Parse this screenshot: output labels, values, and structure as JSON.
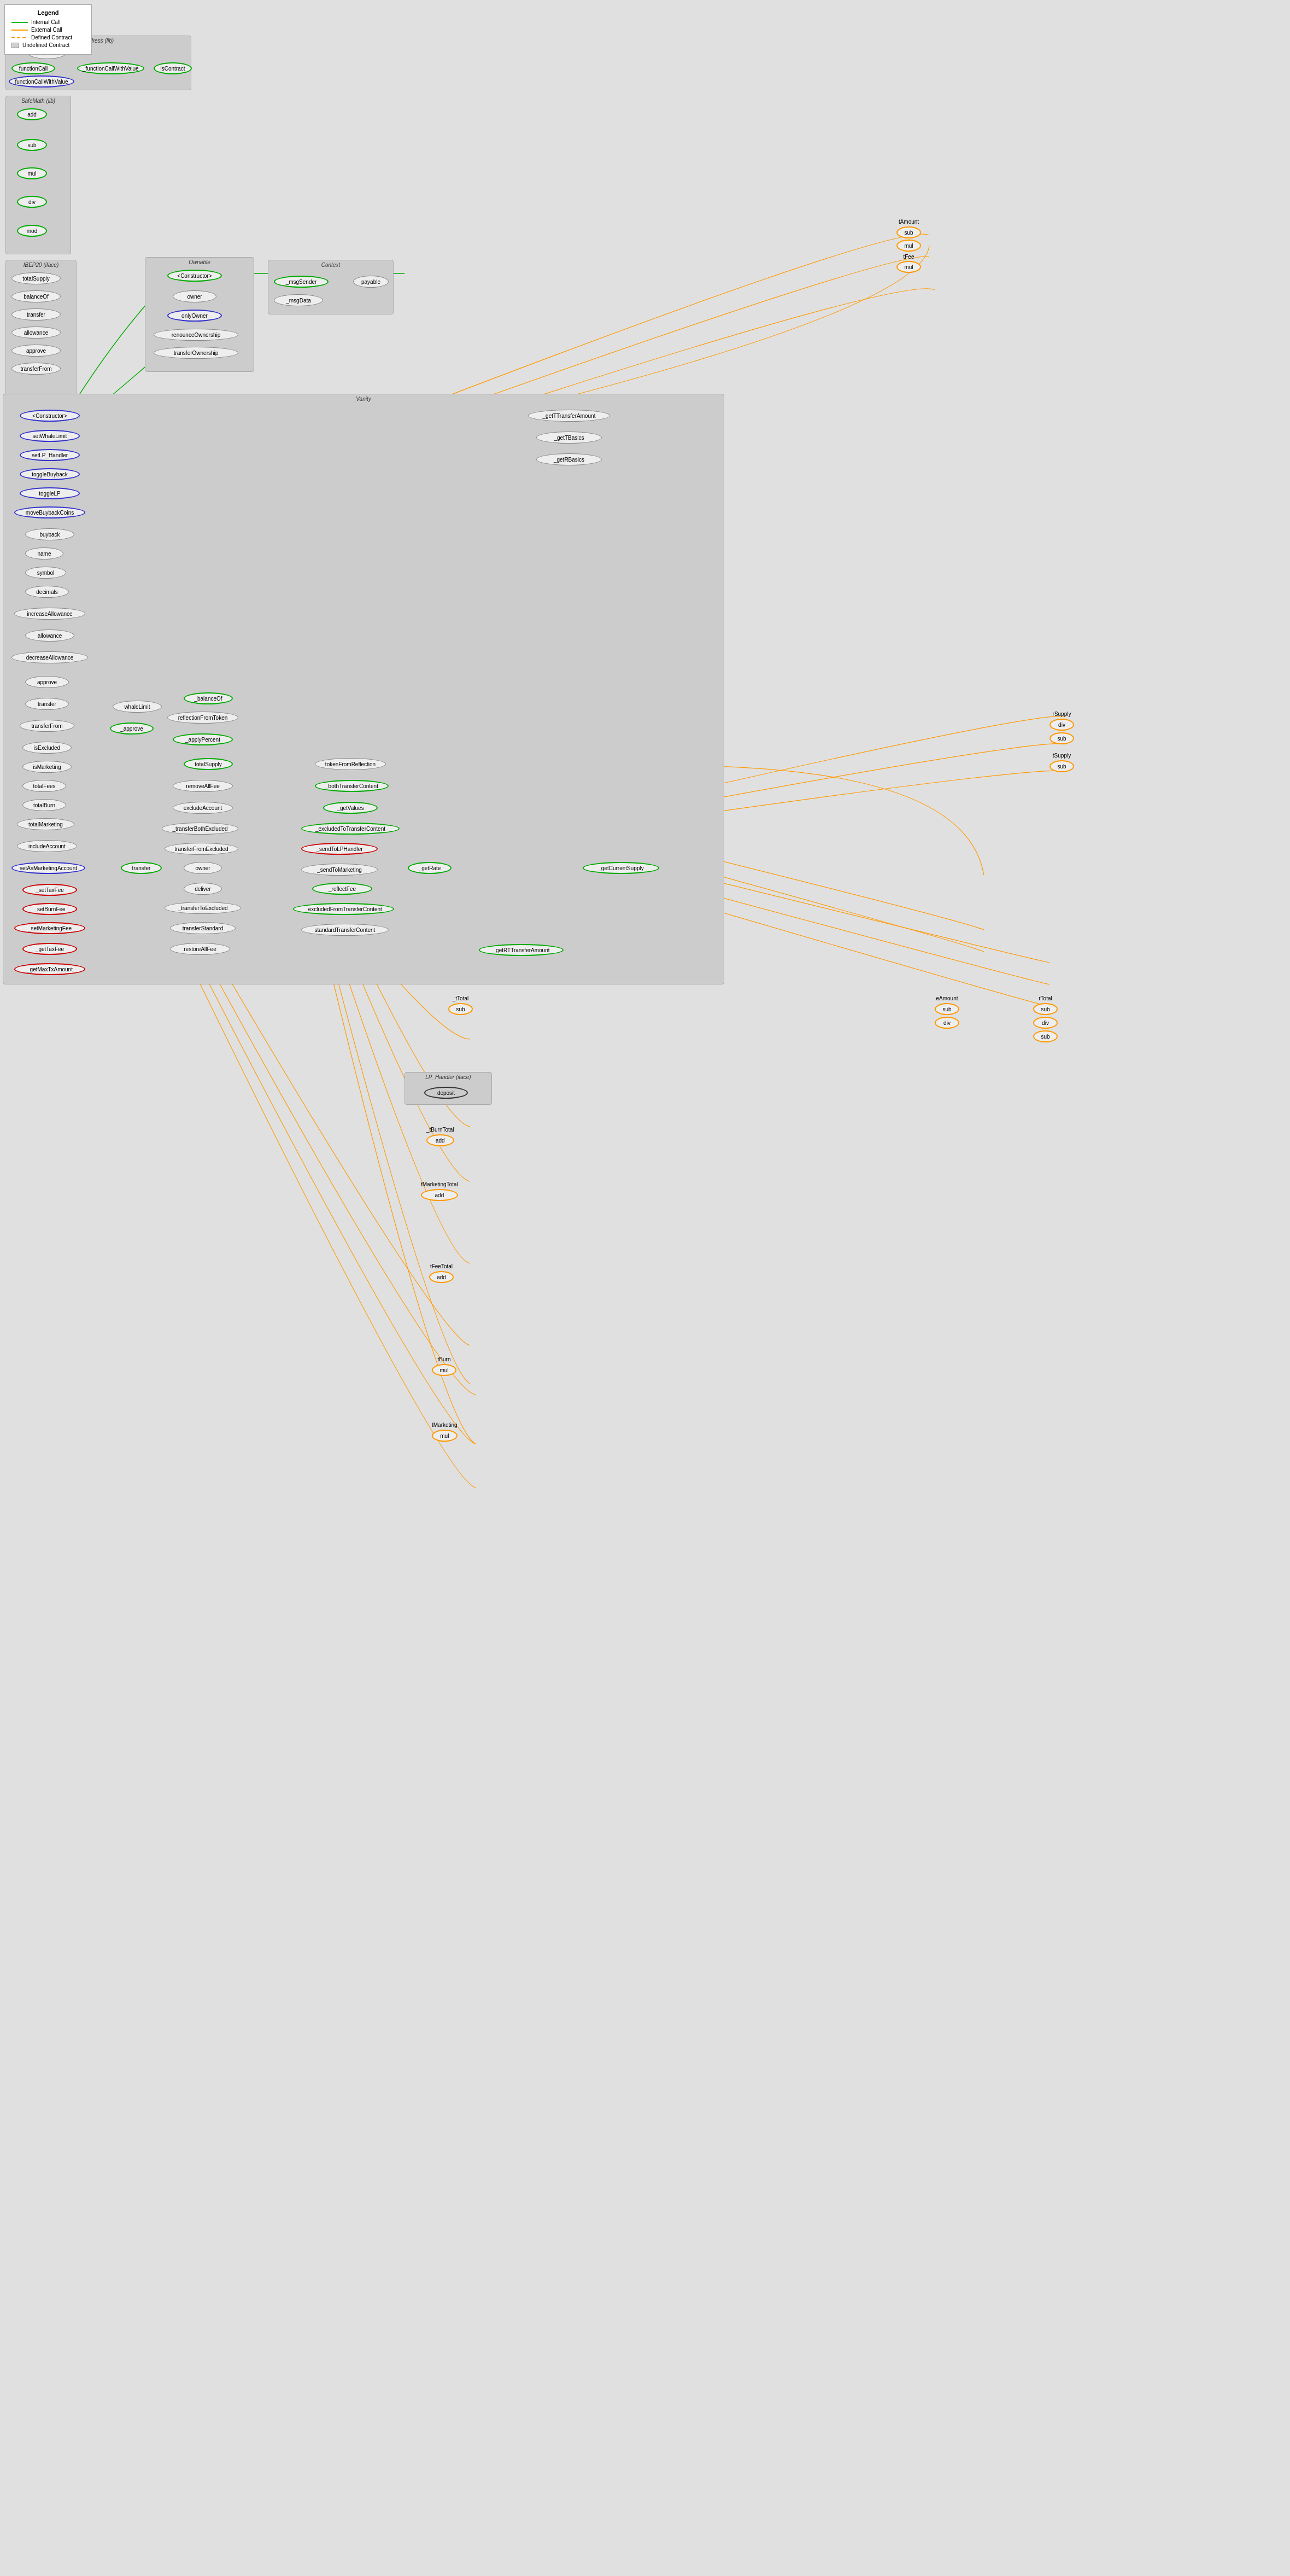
{
  "legend": {
    "title": "Legend",
    "items": [
      {
        "label": "Internal Call",
        "type": "green-line"
      },
      {
        "label": "External Call",
        "type": "orange-line"
      },
      {
        "label": "Defined Contract",
        "type": "dashed-orange"
      },
      {
        "label": "Undefined Contract",
        "type": "rect"
      }
    ]
  },
  "groups": {
    "address": {
      "title": "Address  (lib)",
      "nodes": [
        "sendValue",
        "functionCall",
        "_functionCallWithValue",
        "isContract",
        "functionCallWithValue"
      ]
    },
    "safemath": {
      "title": "SafeMath  (lib)",
      "nodes": [
        "add",
        "sub",
        "mul",
        "div",
        "mod"
      ]
    },
    "ibep20": {
      "title": "IBEP20  (iface)",
      "nodes": [
        "totalSupply",
        "balanceOf",
        "transfer",
        "allowance",
        "approve",
        "transferFrom"
      ]
    },
    "ownable": {
      "title": "Ownable",
      "nodes": [
        "<Constructor>",
        "owner",
        "onlyOwner",
        "renounceOwnership",
        "transferOwnership"
      ]
    },
    "context": {
      "title": "Context",
      "nodes": [
        "_msgSender",
        "_msgData",
        "payable"
      ]
    },
    "vanity": {
      "title": "Vanity",
      "nodes": [
        "<Constructor>",
        "setWhaleLimit",
        "setLP_Handler",
        "toggleBuyback",
        "toggleLP",
        "moveBuybackCoins",
        "buyback",
        "name",
        "symbol",
        "decimals",
        "increaseAllowance",
        "allowance",
        "decreaseAllowance",
        "approve",
        "transfer",
        "transferFrom",
        "isExcluded",
        "isMarketing",
        "totalFees",
        "totalBurn",
        "totalMarketing",
        "includeAccount",
        "setAsMarketingAccount",
        "_setTaxFee",
        "_setBurnFee",
        "_setMarketingFee",
        "_getTaxFee",
        "_getMaxTxAmount",
        "whaleLimit",
        "_balanceOf",
        "reflectionFromToken",
        "_applyPercent",
        "totalSupply",
        "_approve",
        "removeAllFee",
        "excludeAccount",
        "_transferBothExcluded",
        "transferFromExcluded",
        "transfer_",
        "owner",
        "deliver",
        "_transferToExcluded",
        "transferStandard",
        "restoreAllFee",
        "tokenFromReflection",
        "_bothTransferContent",
        "_getValues",
        "_excludedToTransferContent",
        "_getRate",
        "_sendToLPHandler",
        "_sendToMarketing",
        "_reflectFee",
        "_excludedFromTransferContent",
        "standardTransferContent",
        "_getTTransferAmount",
        "_getTBasics",
        "_getRBasics",
        "_getRTTransferAmount",
        "_getCurrentSupply"
      ]
    },
    "lphandler": {
      "title": "LP_Handler  (iface)",
      "nodes": [
        "deposit"
      ]
    }
  },
  "standalone_nodes": {
    "tAmount_sub": "sub",
    "tAmount_mul": "mul",
    "tFee_mul": "mul",
    "rSupply_div": "div",
    "rSupply_sub": "sub",
    "tSupply_sub": "sub",
    "tTotal_sub": "sub",
    "eAmount_sub": "sub",
    "eAmount_div": "div",
    "rTotal_sub": "sub",
    "rTotal_div": "div",
    "tBurnTotal_add": "add",
    "tMarketingTotal_add": "add",
    "tFeeTotal_add": "add",
    "tBurn_mul": "mul",
    "tMarketing_mul": "mul"
  }
}
